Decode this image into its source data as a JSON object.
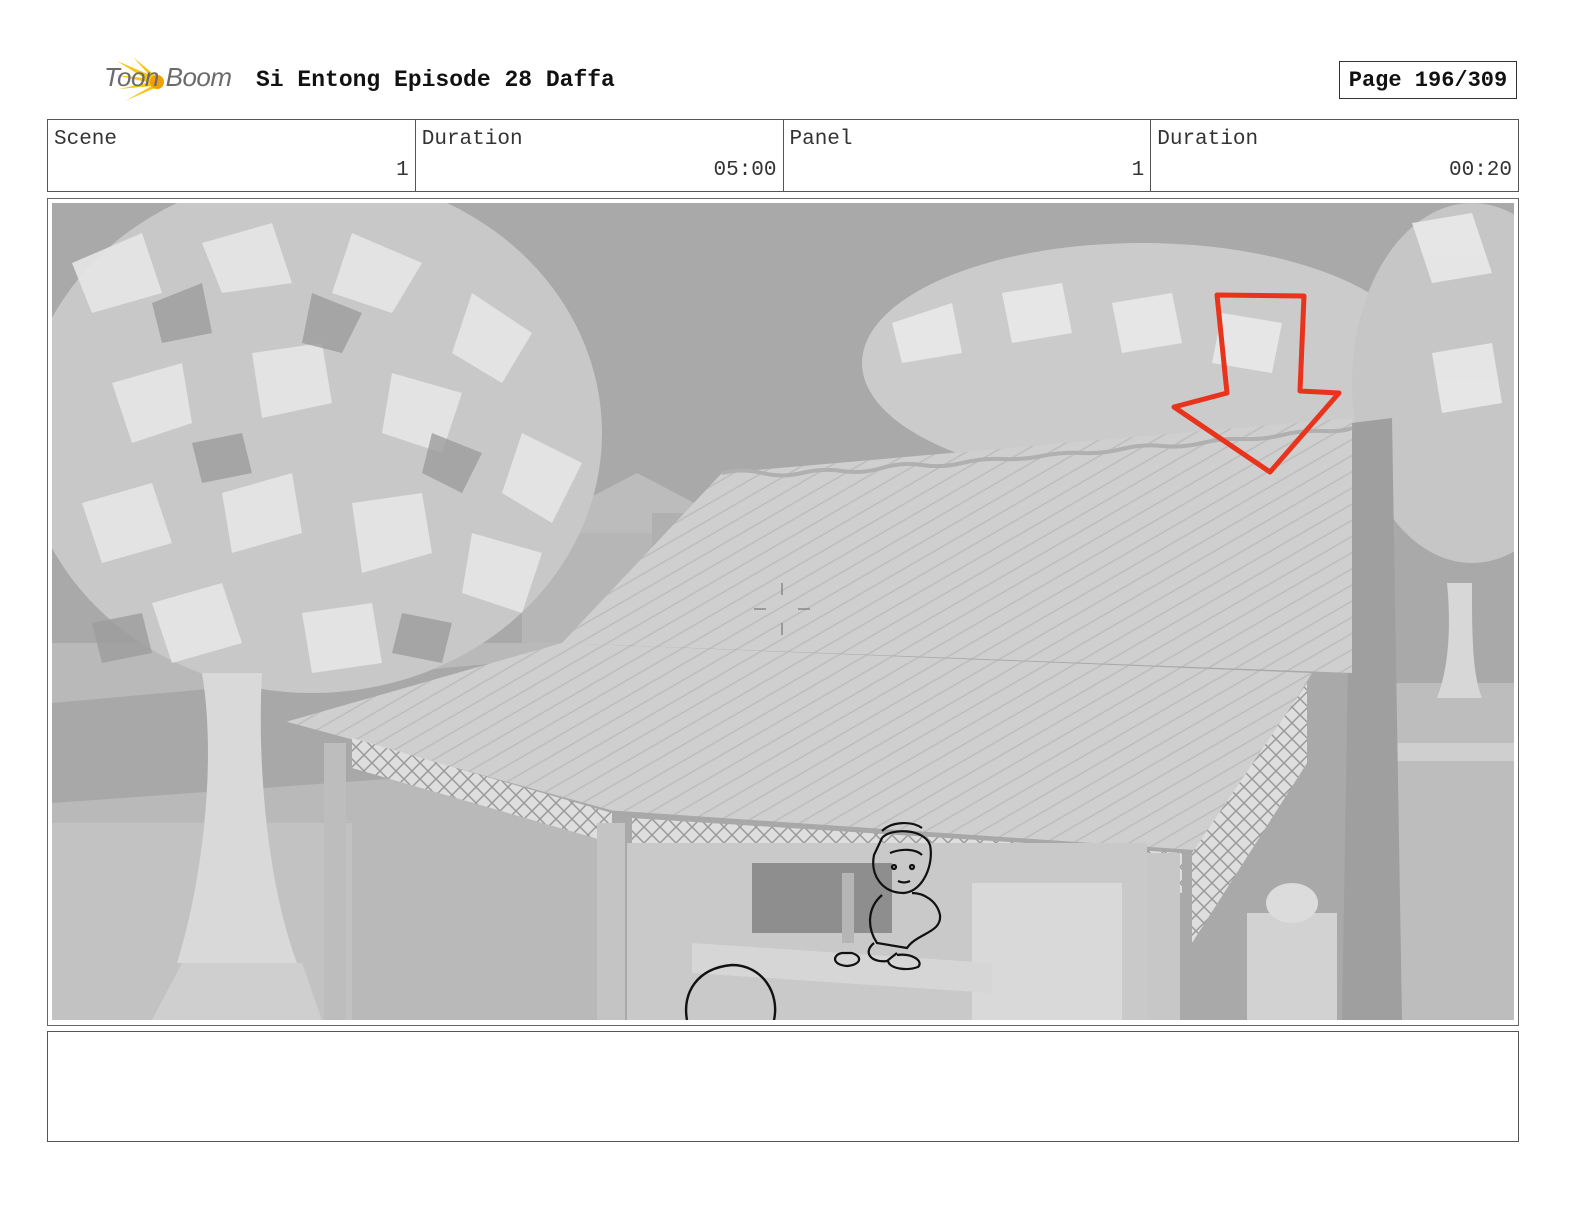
{
  "header": {
    "brand": "Toon Boom",
    "title": "Si Entong Episode 28 Daffa",
    "page": "Page 196/309"
  },
  "info": {
    "scene_label": "Scene",
    "scene_value": "1",
    "scene_duration_label": "Duration",
    "scene_duration_value": "05:00",
    "panel_label": "Panel",
    "panel_value": "1",
    "panel_duration_label": "Duration",
    "panel_duration_value": "00:20"
  },
  "notes": {
    "text": ""
  },
  "colors": {
    "logo_yellow": "#f5c518",
    "arrow_red": "#e8341c",
    "sky": "#a9a9a9"
  }
}
